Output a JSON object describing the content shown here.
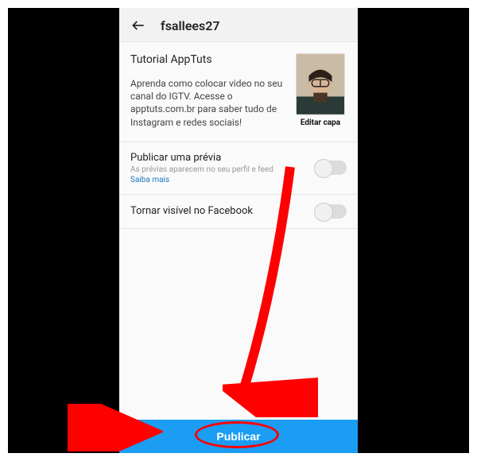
{
  "header": {
    "username": "fsallees27"
  },
  "video": {
    "title": "Tutorial AppTuts",
    "description": "Aprenda como colocar video no seu canal do IGTV. Acesse o apptuts.com.br para saber tudo de Instagram e redes sociais!",
    "edit_cover_label": "Editar capa"
  },
  "options": {
    "preview_label": "Publicar uma prévia",
    "preview_sub": "As prévias aparecem no seu perfil e feed",
    "preview_link": "Saiba mais",
    "facebook_label": "Tornar visível no Facebook"
  },
  "actions": {
    "publish_label": "Publicar"
  },
  "colors": {
    "primary": "#1b9df3",
    "annotation": "#ff0000"
  }
}
